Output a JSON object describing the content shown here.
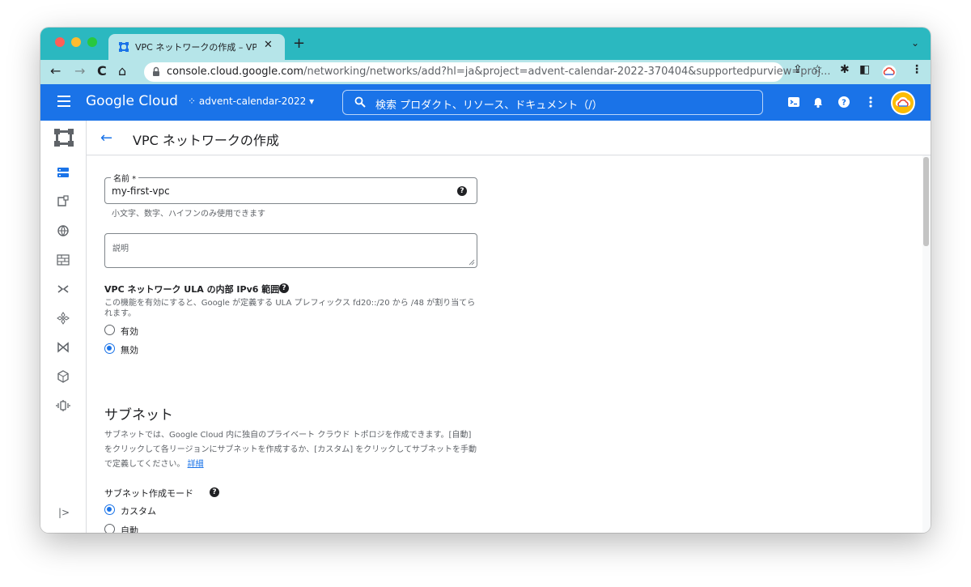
{
  "browser": {
    "tab_title": "VPC ネットワークの作成 – VPC ネ",
    "url_host": "console.cloud.google.com",
    "url_rest": "/networking/networks/add?hl=ja&project=advent-calendar-2022-370404&supportedpurview=proj..."
  },
  "header": {
    "brand": "Google Cloud",
    "project": "advent-calendar-2022",
    "search_placeholder": "検索  プロダクト、リソース、ドキュメント（/）"
  },
  "page": {
    "back_arrow": "←",
    "title": "VPC ネットワークの作成"
  },
  "form": {
    "name_label": "名前 *",
    "name_value": "my-first-vpc",
    "name_hint": "小文字、数字、ハイフンのみ使用できます",
    "description_placeholder": "説明",
    "ula": {
      "title": "VPC ネットワーク ULA の内部 IPv6 範囲",
      "description": "この機能を有効にすると、Google が定義する ULA プレフィックス fd20::/20 から /48 が割り当てられます。",
      "options": [
        "有効",
        "無効"
      ],
      "selected": "無効"
    },
    "subnet": {
      "heading": "サブネット",
      "description": "サブネットでは、Google Cloud 内に独自のプライベート クラウド トポロジを作成できます。[自動] をクリックして各リージョンにサブネットを作成するか、[カスタム] をクリックしてサブネットを手動で定義してください。",
      "link": "詳細",
      "mode_title": "サブネット作成モード",
      "options": [
        "カスタム",
        "自動"
      ],
      "selected": "カスタム"
    }
  },
  "colors": {
    "tab_strip": "#2bb8c0",
    "gcp_blue": "#1a73e8",
    "text": "#202124",
    "secondary_text": "#5f6368"
  }
}
